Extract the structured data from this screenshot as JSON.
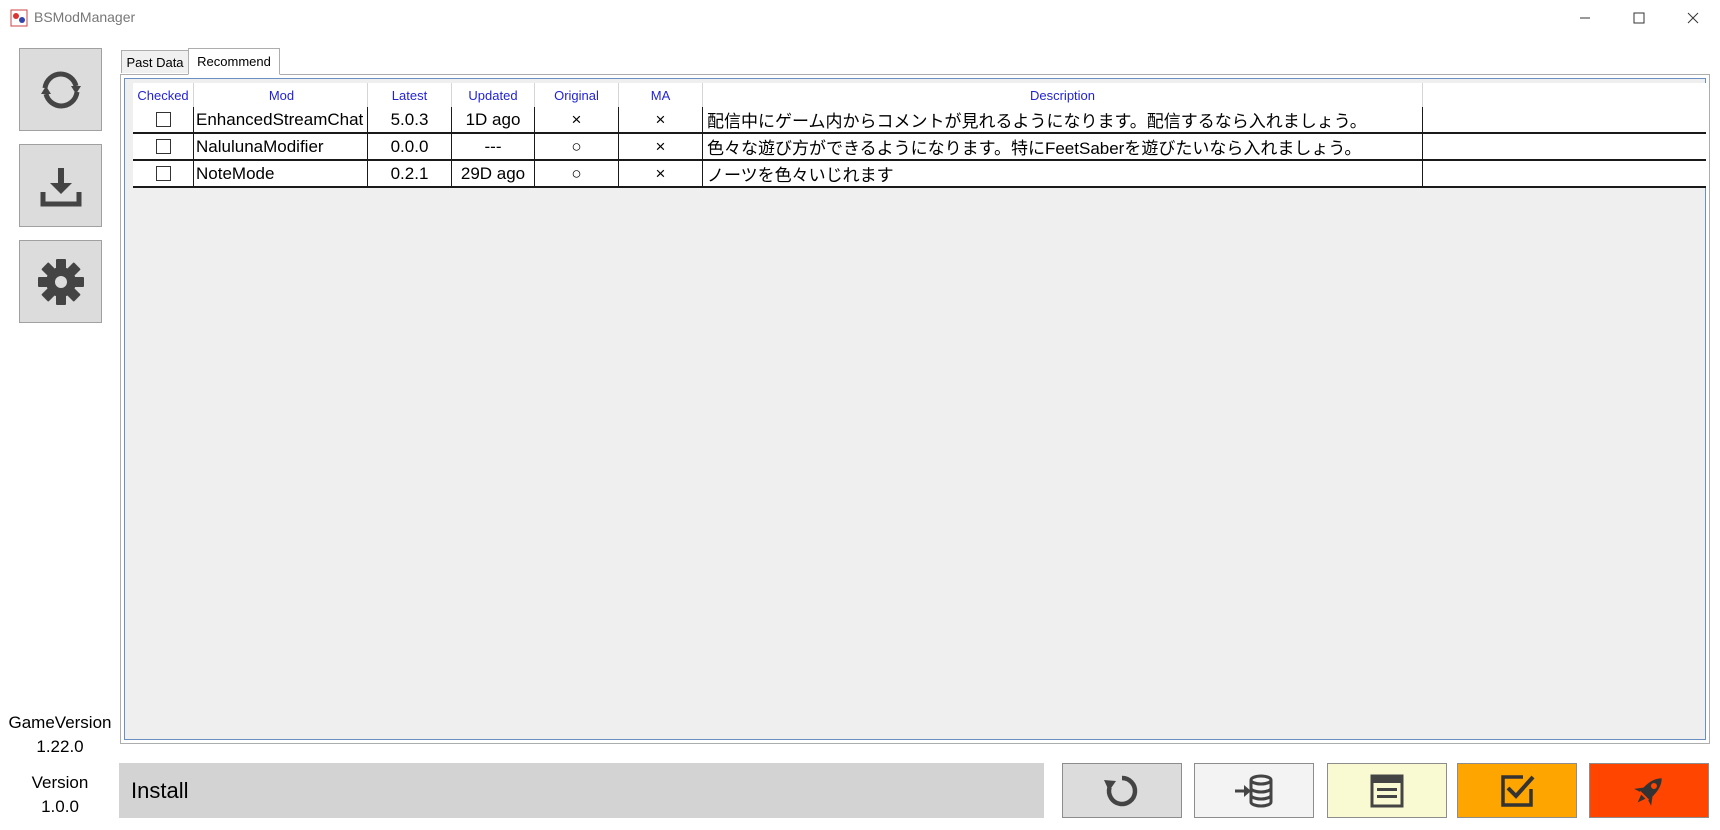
{
  "window": {
    "title": "BSModManager"
  },
  "sidebar": {
    "buttons": [
      {
        "icon": "refresh-icon"
      },
      {
        "icon": "download-icon"
      },
      {
        "icon": "gear-icon"
      }
    ],
    "game_version_label": "GameVersion",
    "game_version_value": "1.22.0",
    "version_label": "Version",
    "version_value": "1.0.0"
  },
  "tabs": [
    {
      "label": "Past Data",
      "active": false
    },
    {
      "label": "Recommend",
      "active": true
    }
  ],
  "grid": {
    "columns": [
      "Checked",
      "Mod",
      "Latest",
      "Updated",
      "Original",
      "MA",
      "Description"
    ],
    "rows": [
      {
        "checked": false,
        "mod": "EnhancedStreamChat",
        "latest": "5.0.3",
        "updated": "1D ago",
        "original": "×",
        "ma": "×",
        "description": "配信中にゲーム内からコメントが見れるようになります。配信するなら入れましょう。"
      },
      {
        "checked": false,
        "mod": "NalulunaModifier",
        "latest": "0.0.0",
        "updated": "---",
        "original": "○",
        "ma": "×",
        "description": "色々な遊び方ができるようになります。特にFeetSaberを遊びたいなら入れましょう。"
      },
      {
        "checked": false,
        "mod": "NoteMode",
        "latest": "0.2.1",
        "updated": "29D ago",
        "original": "○",
        "ma": "×",
        "description": "ノーツを色々いじれます"
      }
    ]
  },
  "bottom": {
    "status_text": "Install",
    "buttons": [
      {
        "icon": "reload-icon",
        "color": "#dcdcdc"
      },
      {
        "icon": "database-import-icon",
        "color": "#f3f3f3"
      },
      {
        "icon": "layout-icon",
        "color": "#fafad2"
      },
      {
        "icon": "check-box-icon",
        "color": "#ffa500"
      },
      {
        "icon": "rocket-icon",
        "color": "#ff4500"
      }
    ]
  },
  "colors": {
    "header_text": "#2323d6",
    "grid_border": "#6b8fc1"
  }
}
